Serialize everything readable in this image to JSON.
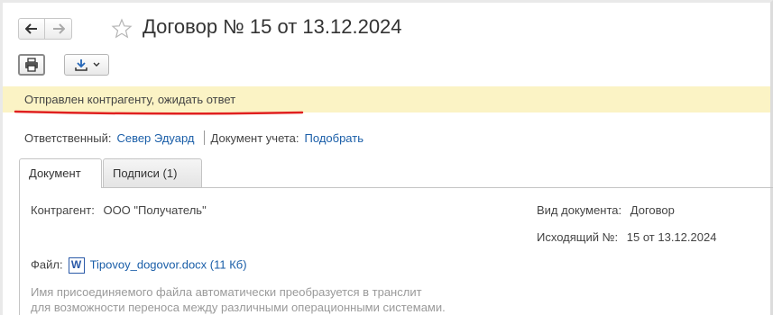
{
  "header": {
    "title": "Договор № 15 от 13.12.2024"
  },
  "status": {
    "text": "Отправлен контрагенту, ожидать ответ",
    "underline_color": "#e02020",
    "background": "#fbf3c5"
  },
  "responsible": {
    "label": "Ответственный:",
    "value": "Север Эдуард",
    "doc_label": "Документ учета:",
    "doc_link": "Подобрать"
  },
  "tabs": [
    {
      "label": "Документ",
      "active": true
    },
    {
      "label": "Подписи (1)",
      "active": false
    }
  ],
  "form": {
    "counterparty_label": "Контрагент:",
    "counterparty_value": "ООО \"Получатель\"",
    "doc_type_label": "Вид документа:",
    "doc_type_value": "Договор",
    "outgoing_label": "Исходящий №:",
    "outgoing_value": "15 от 13.12.2024",
    "file_label": "Файл:",
    "file_icon": "W",
    "file_link": "Tipovoy_dogovor.docx (11 Кб)",
    "hint_line1": "Имя присоединяемого файла автоматически преобразуется в транслит",
    "hint_line2": "для возможности переноса между различными операционными системами."
  },
  "icons": {
    "back": "arrow-left-icon",
    "forward": "arrow-right-icon",
    "favorite": "star-icon",
    "print": "printer-icon",
    "export": "download-icon"
  },
  "colors": {
    "link": "#1a5ea8",
    "accent_red": "#e02020"
  }
}
